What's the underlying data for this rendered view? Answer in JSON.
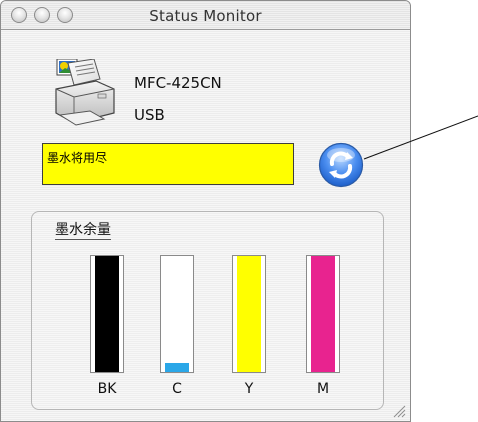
{
  "window": {
    "title": "Status Monitor"
  },
  "printer": {
    "model": "MFC-425CN",
    "connection": "USB"
  },
  "status": {
    "message": "墨水将用尽",
    "background_color": "#ffff00"
  },
  "refresh": {
    "icon": "refresh-icon"
  },
  "ink": {
    "title": "墨水余量",
    "cartridges": [
      {
        "label": "BK",
        "color": "#000000",
        "level": 1.0
      },
      {
        "label": "C",
        "color": "#2aa7e8",
        "level": 0.08
      },
      {
        "label": "Y",
        "color": "#ffff00",
        "level": 1.0
      },
      {
        "label": "M",
        "color": "#e8238f",
        "level": 1.0
      }
    ]
  }
}
